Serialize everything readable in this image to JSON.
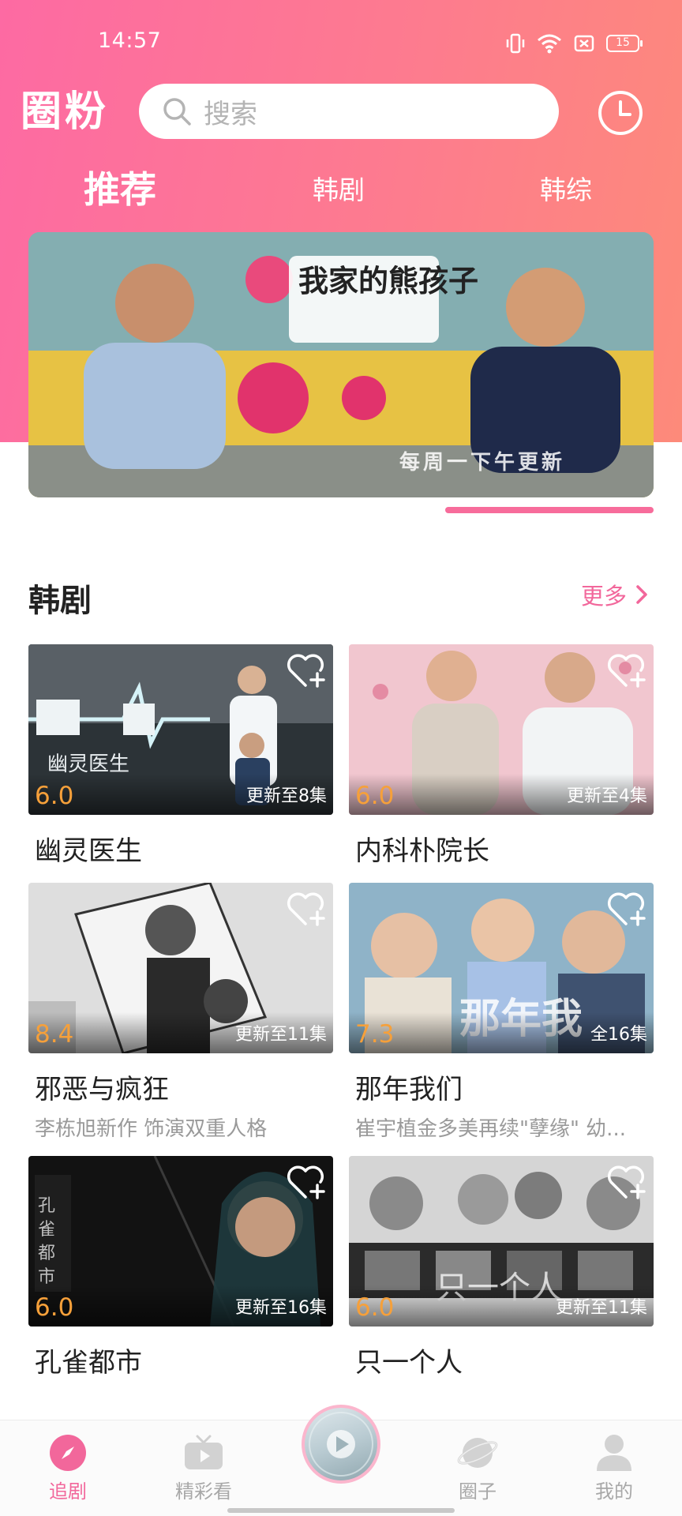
{
  "status_bar": {
    "time": "14:57",
    "battery": "15"
  },
  "header": {
    "logo_text": "圈粉",
    "search_placeholder": "搜索"
  },
  "tabs": [
    {
      "label": "推荐",
      "active": true
    },
    {
      "label": "韩剧",
      "active": false
    },
    {
      "label": "韩综",
      "active": false
    }
  ],
  "banner": {
    "title": "我家的熊孩子",
    "caption": "每周一下午更新"
  },
  "section": {
    "title": "韩剧",
    "more_label": "更多"
  },
  "cards": [
    {
      "title": "幽灵医生",
      "rating": "6.0",
      "episodes": "更新至8集",
      "subtitle": "",
      "poster_text": "幽灵医生"
    },
    {
      "title": "内科朴院长",
      "rating": "6.0",
      "episodes": "更新至4集",
      "subtitle": ""
    },
    {
      "title": "邪恶与疯狂",
      "rating": "8.4",
      "episodes": "更新至11集",
      "subtitle": "李栋旭新作 饰演双重人格"
    },
    {
      "title": "那年我们",
      "rating": "7.3",
      "episodes": "全16集",
      "subtitle": "崔宇植金多美再续\"孽缘\" 幼...",
      "poster_text": "那年我"
    },
    {
      "title": "孔雀都市",
      "rating": "6.0",
      "episodes": "更新至16集",
      "subtitle": "",
      "poster_text": "孔雀都市"
    },
    {
      "title": "只一个人",
      "rating": "6.0",
      "episodes": "更新至11集",
      "subtitle": "",
      "poster_text": "只一个人"
    }
  ],
  "bottom_nav": [
    {
      "label": "追剧",
      "icon": "compass-icon",
      "active": true
    },
    {
      "label": "精彩看",
      "icon": "tv-icon",
      "active": false
    },
    {
      "label": "",
      "icon": "play-disc-icon",
      "active": false
    },
    {
      "label": "圈子",
      "icon": "planet-icon",
      "active": false
    },
    {
      "label": "我的",
      "icon": "user-icon",
      "active": false
    }
  ],
  "colors": {
    "accent": "#f2679b",
    "rating": "#f6a03a",
    "header_gradient_start": "#fd6aa3",
    "header_gradient_end": "#fd8a7a"
  }
}
